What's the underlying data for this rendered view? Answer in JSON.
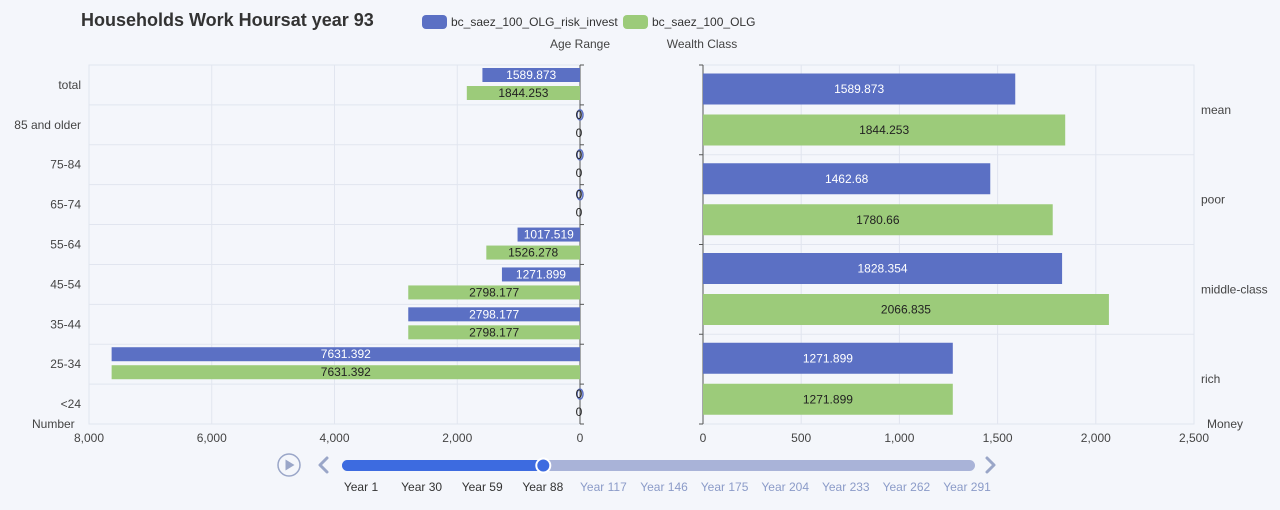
{
  "title": "Households Work Hoursat year 93",
  "colors": {
    "series1": "#5b70c4",
    "series2": "#9ccb7a",
    "grid": "#e1e5ef",
    "axis": "#555555",
    "timeline_active": "#3d6be0",
    "timeline_track": "#a9b3d8",
    "timeline_future_text": "#8b9bc8",
    "timeline_past_text": "#333333",
    "play_icon": "#9aa6c8"
  },
  "chart_data": [
    {
      "type": "bar",
      "orientation": "horizontal",
      "inverse_x": true,
      "title": "Households Work Hoursat year 93",
      "axis_name_top": "Age Range",
      "axis_name_bottom": "Number",
      "categories": [
        "total",
        "85 and older",
        "75-84",
        "65-74",
        "55-64",
        "45-54",
        "35-44",
        "25-34",
        "<24"
      ],
      "xlim": [
        0,
        8000
      ],
      "xticks": [
        8000,
        6000,
        4000,
        2000,
        0
      ],
      "xtick_labels": [
        "8,000",
        "6,000",
        "4,000",
        "2,000",
        "0"
      ],
      "series": [
        {
          "name": "bc_saez_100_OLG_risk_invest",
          "values": [
            1589.873,
            0,
            0,
            0,
            1017.519,
            1271.899,
            2798.177,
            7631.392,
            0
          ],
          "labels": [
            "1589.873",
            "0",
            "0",
            "0",
            "1017.519",
            "1271.899",
            "2798.177",
            "7631.392",
            "0"
          ]
        },
        {
          "name": "bc_saez_100_OLG",
          "values": [
            1844.253,
            0,
            0,
            0,
            1526.278,
            2798.177,
            2798.177,
            7631.392,
            0
          ],
          "labels": [
            "1844.253",
            "0",
            "0",
            "0",
            "1526.278",
            "2798.177",
            "2798.177",
            "7631.392",
            "0"
          ]
        }
      ]
    },
    {
      "type": "bar",
      "orientation": "horizontal",
      "axis_name_top": "Wealth Class",
      "axis_name_bottom": "Money",
      "categories": [
        "mean",
        "poor",
        "middle-class",
        "rich"
      ],
      "xlim": [
        0,
        2500
      ],
      "xticks": [
        0,
        500,
        1000,
        1500,
        2000,
        2500
      ],
      "xtick_labels": [
        "0",
        "500",
        "1,000",
        "1,500",
        "2,000",
        "2,500"
      ],
      "series": [
        {
          "name": "bc_saez_100_OLG_risk_invest",
          "values": [
            1589.873,
            1462.68,
            1828.354,
            1271.899
          ],
          "labels": [
            "1589.873",
            "1462.68",
            "1828.354",
            "1271.899"
          ]
        },
        {
          "name": "bc_saez_100_OLG",
          "values": [
            1844.253,
            1780.66,
            2066.835,
            1271.899
          ],
          "labels": [
            "1844.253",
            "1780.66",
            "2066.835",
            "1271.899"
          ]
        }
      ]
    }
  ],
  "legend": [
    {
      "name": "bc_saez_100_OLG_risk_invest"
    },
    {
      "name": "bc_saez_100_OLG"
    }
  ],
  "timeline": {
    "labels": [
      "Year 1",
      "Year 30",
      "Year 59",
      "Year 88",
      "Year 117",
      "Year 146",
      "Year 175",
      "Year 204",
      "Year 233",
      "Year 262",
      "Year 291"
    ],
    "current_index": 3,
    "current_fraction": 0.318
  }
}
